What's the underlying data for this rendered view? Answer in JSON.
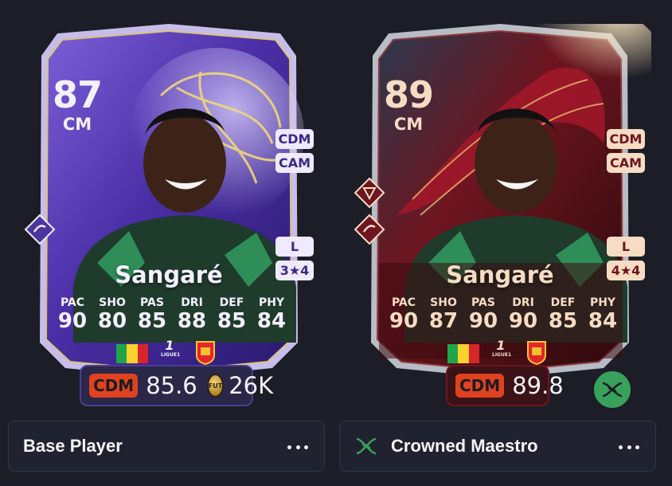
{
  "cards": [
    {
      "rating": "87",
      "position": "CM",
      "alt_positions": [
        "CDM",
        "CAM"
      ],
      "preferred_foot": "L",
      "skill_weak": "3★4",
      "name": "Sangaré",
      "stats": [
        {
          "label": "PAC",
          "value": "90"
        },
        {
          "label": "SHO",
          "value": "80"
        },
        {
          "label": "PAS",
          "value": "85"
        },
        {
          "label": "DRI",
          "value": "88"
        },
        {
          "label": "DEF",
          "value": "85"
        },
        {
          "label": "PHY",
          "value": "84"
        }
      ],
      "league_logo_text": "LIGUE1",
      "price_position": "CDM",
      "price_rating": "85.6",
      "coin_label": "FUT",
      "price": "26K",
      "label": "Base Player",
      "text_color": "#f4f1ff",
      "theme": "purple"
    },
    {
      "rating": "89",
      "position": "CM",
      "alt_positions": [
        "CDM",
        "CAM"
      ],
      "preferred_foot": "L",
      "skill_weak": "4★4",
      "name": "Sangaré",
      "stats": [
        {
          "label": "PAC",
          "value": "90"
        },
        {
          "label": "SHO",
          "value": "87"
        },
        {
          "label": "PAS",
          "value": "90"
        },
        {
          "label": "DRI",
          "value": "90"
        },
        {
          "label": "DEF",
          "value": "85"
        },
        {
          "label": "PHY",
          "value": "84"
        }
      ],
      "league_logo_text": "LIGUE1",
      "price_position": "CDM",
      "price_rating": "89.8",
      "label": "Crowned Maestro",
      "text_color": "#f5dcc3",
      "theme": "red"
    }
  ],
  "icons": {
    "more": "more-dots-icon",
    "evo": "dna-icon"
  },
  "colors": {
    "background": "#1c1d26",
    "price_accent": "#e0421f",
    "evo_green": "#38a15c"
  }
}
